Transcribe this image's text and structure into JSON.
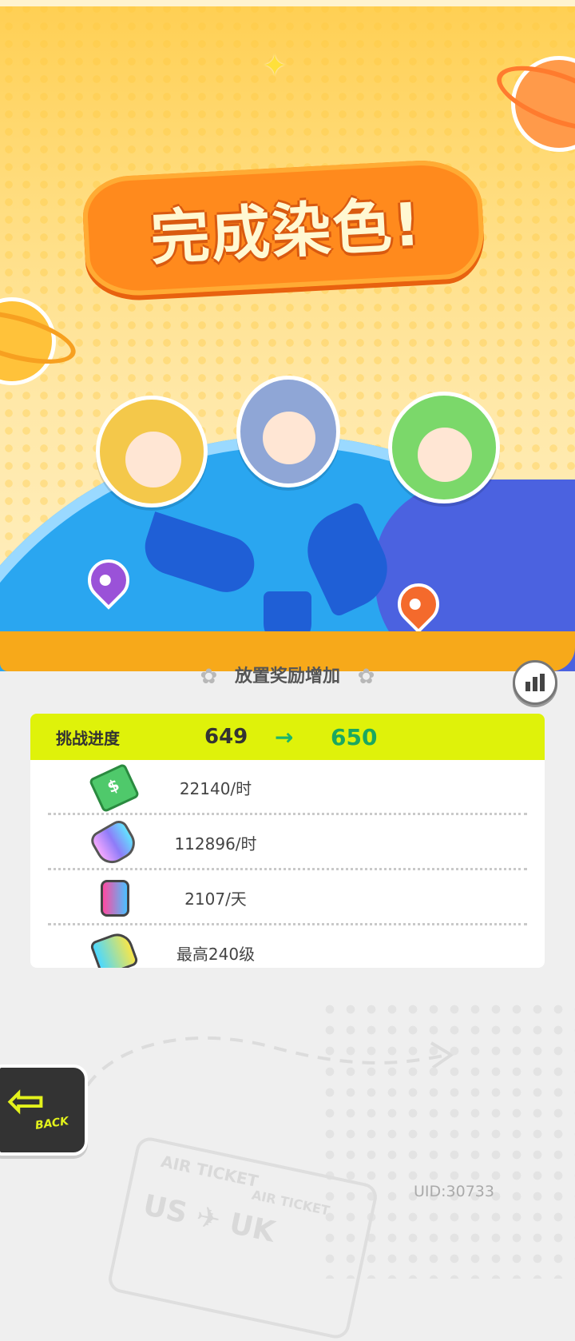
{
  "scene": {
    "title": "完成染色!"
  },
  "panel": {
    "header": "放置奖励增加",
    "stats_icon": "bar-chart-icon",
    "progress": {
      "label": "挑战进度",
      "from": "649",
      "arrow": "→",
      "to": "650"
    },
    "rewards": [
      {
        "icon": "cash-icon",
        "value": "22140/时"
      },
      {
        "icon": "paint-tube-icon",
        "value": "112896/时"
      },
      {
        "icon": "spray-can-icon",
        "value": "2107/天"
      },
      {
        "icon": "paint-gun-icon",
        "value": "最高240级"
      }
    ]
  },
  "back_button": {
    "label": "BACK"
  },
  "uid": "UID:30733",
  "colors": {
    "accent": "#dff20a",
    "progress_to": "#1aa860",
    "title_bg": "#ff8a1d"
  }
}
